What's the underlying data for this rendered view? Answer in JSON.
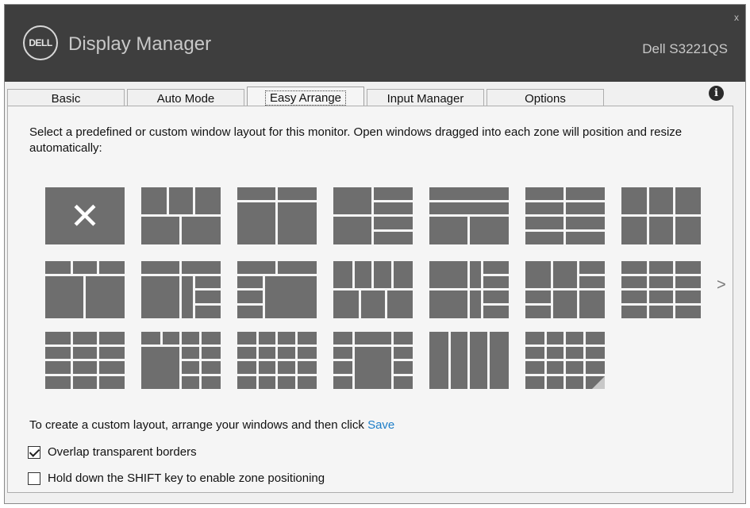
{
  "header": {
    "logo_text": "DELL",
    "app_title": "Display Manager",
    "model": "Dell S3221QS",
    "close_label": "x"
  },
  "tabs": [
    {
      "label": "Basic"
    },
    {
      "label": "Auto Mode"
    },
    {
      "label": "Easy Arrange",
      "active": true
    },
    {
      "label": "Input Manager"
    },
    {
      "label": "Options"
    }
  ],
  "info_label": "i",
  "description": "Select a predefined or custom window layout for this monitor.  Open windows dragged into each zone will position and resize automatically:",
  "layouts_count_visible": 20,
  "next_label": ">",
  "custom_text": "To create a custom layout, arrange your windows and then click",
  "save_label": "Save",
  "options": [
    {
      "label": "Overlap transparent borders",
      "checked": true
    },
    {
      "label": "Hold down the SHIFT key to enable zone positioning",
      "checked": false
    }
  ],
  "colors": {
    "tile": "#6e6e6e",
    "accent": "#1e7ec8",
    "header": "#3e3e3e"
  }
}
